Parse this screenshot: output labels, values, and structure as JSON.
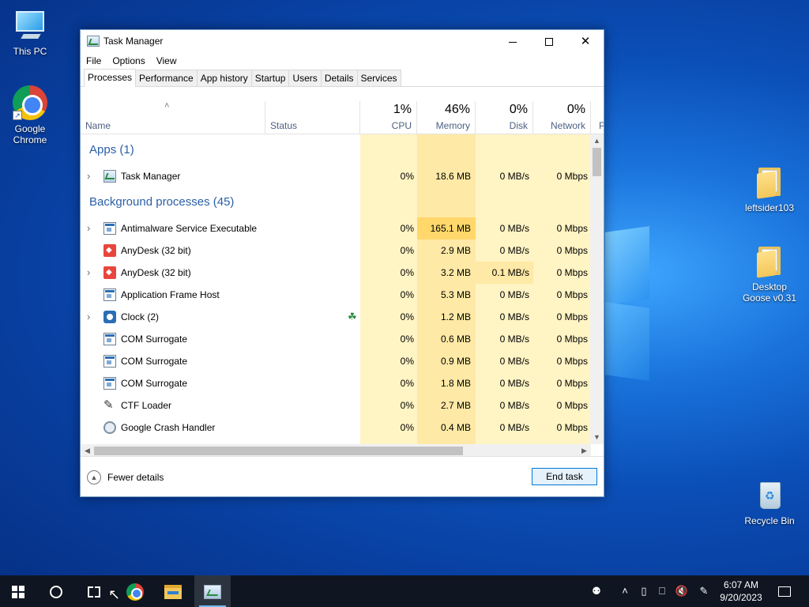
{
  "desktop": {
    "icons": [
      {
        "label": "This PC"
      },
      {
        "label": "Google Chrome"
      },
      {
        "label": "leftsider103"
      },
      {
        "label": "Desktop Goose v0.31"
      },
      {
        "label": "Recycle Bin"
      }
    ]
  },
  "window": {
    "title": "Task Manager",
    "icon": "task-manager-icon"
  },
  "menu": [
    "File",
    "Options",
    "View"
  ],
  "tabs": [
    "Processes",
    "Performance",
    "App history",
    "Startup",
    "Users",
    "Details",
    "Services"
  ],
  "active_tab": "Processes",
  "columns": {
    "name": "Name",
    "status": "Status",
    "cpu": {
      "pct": "1%",
      "label": "CPU"
    },
    "memory": {
      "pct": "46%",
      "label": "Memory"
    },
    "disk": {
      "pct": "0%",
      "label": "Disk"
    },
    "network": {
      "pct": "0%",
      "label": "Network"
    },
    "power_cut": "P"
  },
  "groups": {
    "apps": "Apps (1)",
    "background": "Background processes (45)"
  },
  "apps": [
    {
      "name": "Task Manager",
      "cpu": "0%",
      "memory": "18.6 MB",
      "disk": "0 MB/s",
      "network": "0 Mbps",
      "expandable": true,
      "icon": "task-manager-icon"
    }
  ],
  "processes": [
    {
      "name": "Antimalware Service Executable",
      "cpu": "0%",
      "memory": "165.1 MB",
      "disk": "0 MB/s",
      "network": "0 Mbps",
      "expandable": true,
      "icon": "system-process-icon"
    },
    {
      "name": "AnyDesk (32 bit)",
      "cpu": "0%",
      "memory": "2.9 MB",
      "disk": "0 MB/s",
      "network": "0 Mbps",
      "expandable": false,
      "icon": "anydesk-icon"
    },
    {
      "name": "AnyDesk (32 bit)",
      "cpu": "0%",
      "memory": "3.2 MB",
      "disk": "0.1 MB/s",
      "network": "0 Mbps",
      "expandable": true,
      "icon": "anydesk-icon"
    },
    {
      "name": "Application Frame Host",
      "cpu": "0%",
      "memory": "5.3 MB",
      "disk": "0 MB/s",
      "network": "0 Mbps",
      "expandable": false,
      "icon": "system-process-icon"
    },
    {
      "name": "Clock (2)",
      "cpu": "0%",
      "memory": "1.2 MB",
      "disk": "0 MB/s",
      "network": "0 Mbps",
      "expandable": true,
      "icon": "clock-icon",
      "leaf": true
    },
    {
      "name": "COM Surrogate",
      "cpu": "0%",
      "memory": "0.6 MB",
      "disk": "0 MB/s",
      "network": "0 Mbps",
      "expandable": false,
      "icon": "system-process-icon"
    },
    {
      "name": "COM Surrogate",
      "cpu": "0%",
      "memory": "0.9 MB",
      "disk": "0 MB/s",
      "network": "0 Mbps",
      "expandable": false,
      "icon": "system-process-icon"
    },
    {
      "name": "COM Surrogate",
      "cpu": "0%",
      "memory": "1.8 MB",
      "disk": "0 MB/s",
      "network": "0 Mbps",
      "expandable": false,
      "icon": "system-process-icon"
    },
    {
      "name": "CTF Loader",
      "cpu": "0%",
      "memory": "2.7 MB",
      "disk": "0 MB/s",
      "network": "0 Mbps",
      "expandable": false,
      "icon": "ctf-loader-icon"
    },
    {
      "name": "Google Crash Handler",
      "cpu": "0%",
      "memory": "0.4 MB",
      "disk": "0 MB/s",
      "network": "0 Mbps",
      "expandable": false,
      "icon": "crash-handler-icon"
    }
  ],
  "footer": {
    "fewer_details": "Fewer details",
    "end_task": "End task"
  },
  "taskbar": {
    "clock_time": "6:07 AM",
    "clock_date": "9/20/2023"
  },
  "colors": {
    "heat_light": "#fff4c4",
    "heat_medium": "#ffe9a6",
    "heat_strong": "#ffd76a",
    "group_title": "#2a5fa8",
    "accent": "#0078d7"
  }
}
